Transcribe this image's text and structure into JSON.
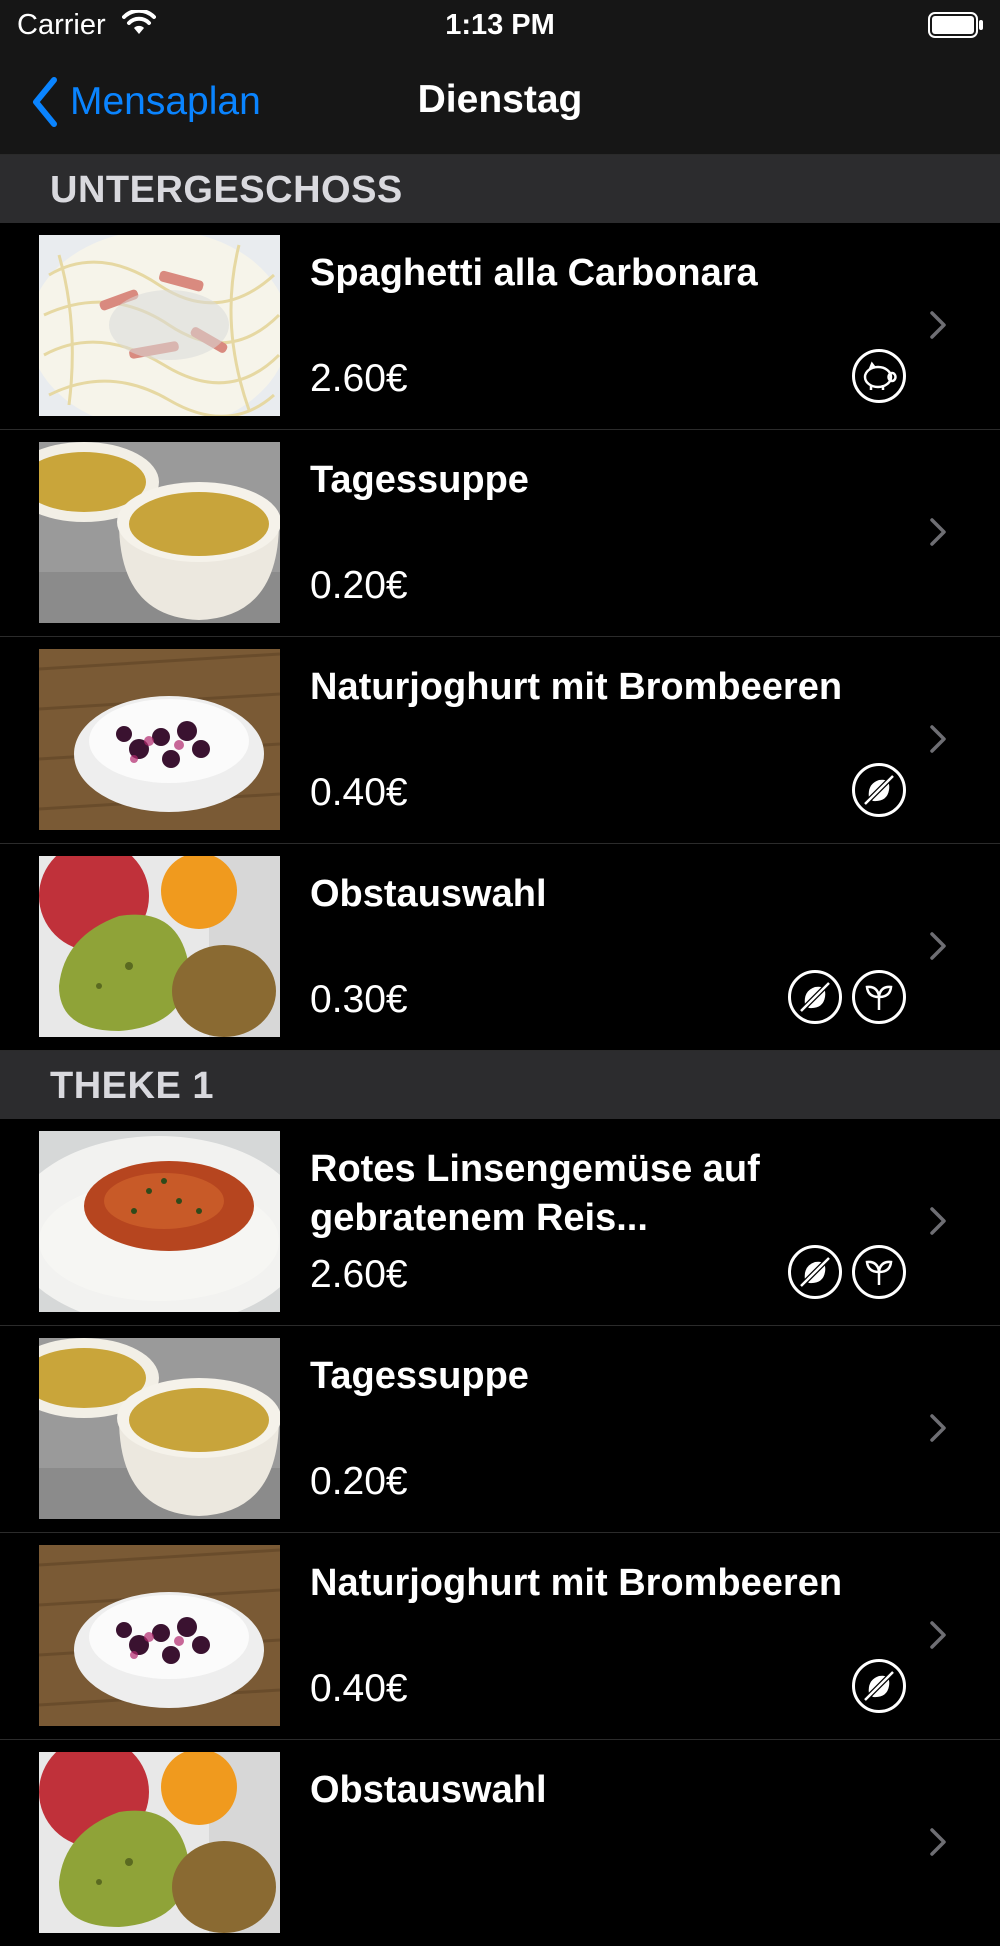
{
  "status_bar": {
    "carrier": "Carrier",
    "time": "1:13 PM"
  },
  "nav": {
    "back_label": "Mensaplan",
    "title": "Dienstag"
  },
  "colors": {
    "accent": "#0a84ff",
    "background": "#000000",
    "section_header": "#2c2c2e"
  },
  "sections": [
    {
      "title": "UNTERGESCHOSS",
      "items": [
        {
          "name": "Spaghetti alla Carbonara",
          "price": "2.60€",
          "image": "pasta",
          "badges": [
            "pig-icon"
          ]
        },
        {
          "name": "Tagessuppe",
          "price": "0.20€",
          "image": "soup",
          "badges": []
        },
        {
          "name": "Naturjoghurt mit Brombeeren",
          "price": "0.40€",
          "image": "yogurt",
          "badges": [
            "no-meat-icon"
          ]
        },
        {
          "name": "Obstauswahl",
          "price": "0.30€",
          "image": "fruit",
          "badges": [
            "no-meat-icon",
            "vegan-leaf-icon"
          ]
        }
      ]
    },
    {
      "title": "THEKE 1",
      "items": [
        {
          "name": "Rotes Linsengemüse auf gebratenem Reis...",
          "price": "2.60€",
          "image": "rice",
          "badges": [
            "no-meat-icon",
            "vegan-leaf-icon"
          ]
        },
        {
          "name": "Tagessuppe",
          "price": "0.20€",
          "image": "soup",
          "badges": []
        },
        {
          "name": "Naturjoghurt mit Brombeeren",
          "price": "0.40€",
          "image": "yogurt",
          "badges": [
            "no-meat-icon"
          ]
        },
        {
          "name": "Obstauswahl",
          "price": "",
          "image": "fruit",
          "badges": []
        }
      ]
    }
  ]
}
